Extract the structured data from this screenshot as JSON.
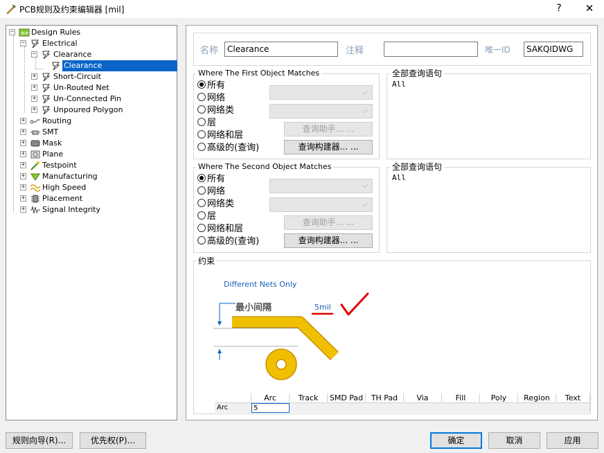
{
  "window": {
    "title": "PCB规则及约束编辑器 [mil]",
    "help": "?",
    "close": "✕"
  },
  "tree": {
    "root": "Design Rules",
    "electrical": "Electrical",
    "clearance_group": "Clearance",
    "clearance_rule": "Clearance",
    "short_circuit": "Short-Circuit",
    "unrouted_net": "Un-Routed Net",
    "unconnected_pin": "Un-Connected Pin",
    "unpoured_polygon": "Unpoured Polygon",
    "routing": "Routing",
    "smt": "SMT",
    "mask": "Mask",
    "plane": "Plane",
    "testpoint": "Testpoint",
    "manufacturing": "Manufacturing",
    "high_speed": "High Speed",
    "placement": "Placement",
    "signal_integrity": "Signal Integrity"
  },
  "header": {
    "name_label": "名称",
    "name_value": "Clearance",
    "comment_label": "注释",
    "comment_value": "",
    "uid_label": "唯一ID",
    "uid_value": "SAKQIDWG"
  },
  "first_match": {
    "title": "Where The First Object Matches",
    "options": [
      "所有",
      "网络",
      "网络类",
      "层",
      "网络和层",
      "高级的(查询)"
    ],
    "query_helper": "查询助手... ...",
    "query_builder": "查询构建器... ...",
    "query_title": "全部查询语句",
    "query_text": "All"
  },
  "second_match": {
    "title": "Where The Second Object Matches",
    "options": [
      "所有",
      "网络",
      "网络类",
      "层",
      "网络和层",
      "高级的(查询)"
    ],
    "query_helper": "查询助手... ...",
    "query_builder": "查询构建器... ...",
    "query_title": "全部查询语句",
    "query_text": "All"
  },
  "constraints": {
    "title": "约束",
    "mode": "Different Nets Only",
    "min_clearance_label": "最小间隔",
    "min_clearance_value": "5mil",
    "grid_headers": [
      "",
      "Arc",
      "Track",
      "SMD Pad",
      "TH Pad",
      "Via",
      "Fill",
      "Poly",
      "Region",
      "Text"
    ],
    "grid_row_label": "Arc",
    "grid_row_value": "5"
  },
  "footer": {
    "rule_wizard": "规则向导(R)...",
    "priorities": "优先权(P)...",
    "ok": "确定",
    "cancel": "取消",
    "apply": "应用"
  },
  "colors": {
    "selection": "#0a64c8",
    "track": "#f0c000",
    "annotation": "#e00000",
    "link": "#1a5fb4"
  }
}
